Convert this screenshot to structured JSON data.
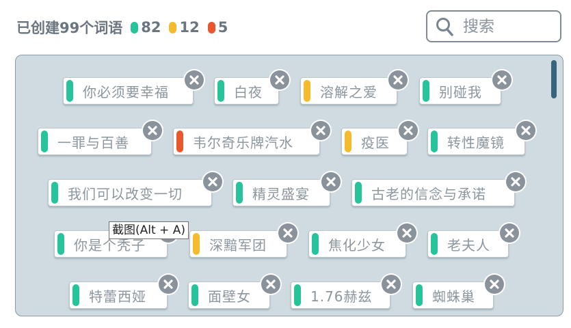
{
  "header": {
    "created_text": "已创建99个词语",
    "counts": [
      {
        "value": "82",
        "color": "#27c39a"
      },
      {
        "value": "12",
        "color": "#f4bb2e"
      },
      {
        "value": "5",
        "color": "#e9572f"
      }
    ]
  },
  "search": {
    "placeholder": "搜索",
    "icon": "search-icon"
  },
  "colors": {
    "green": "#27c39a",
    "yellow": "#f4bb2e",
    "red": "#e9572f",
    "panel_bg": "#cfdbe0"
  },
  "tags": [
    {
      "label": "你必须要幸福",
      "color": "green"
    },
    {
      "label": "白夜",
      "color": "green"
    },
    {
      "label": "溶解之爱",
      "color": "yellow"
    },
    {
      "label": "别碰我",
      "color": "green"
    },
    {
      "label": "一罪与百善",
      "color": "green"
    },
    {
      "label": "韦尔奇乐牌汽水",
      "color": "red"
    },
    {
      "label": "疫医",
      "color": "yellow"
    },
    {
      "label": "转性魔镜",
      "color": "green"
    },
    {
      "label": "我们可以改变一切",
      "color": "green"
    },
    {
      "label": "精灵盛宴",
      "color": "green"
    },
    {
      "label": "古老的信念与承诺",
      "color": "green"
    },
    {
      "label": "你是个秃子",
      "color": "green"
    },
    {
      "label": "深黯军团",
      "color": "yellow"
    },
    {
      "label": "焦化少女",
      "color": "green"
    },
    {
      "label": "老夫人",
      "color": "green"
    },
    {
      "label": "特蕾西娅",
      "color": "green"
    },
    {
      "label": "面壁女",
      "color": "green"
    },
    {
      "label": "1.76赫兹",
      "color": "green"
    },
    {
      "label": "蜘蛛巢",
      "color": "green"
    }
  ],
  "tooltip": {
    "text": "截图(Alt + A)"
  }
}
